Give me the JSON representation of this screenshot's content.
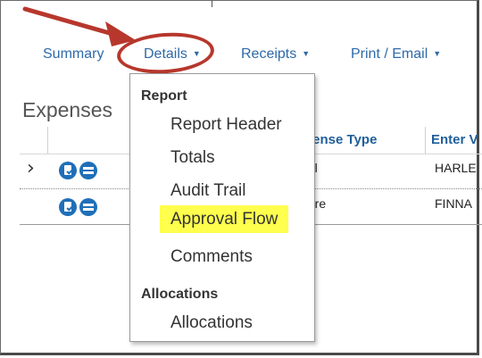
{
  "nav": {
    "tabs": [
      {
        "label": "Summary",
        "has_caret": false
      },
      {
        "label": "Details",
        "has_caret": true
      },
      {
        "label": "Receipts",
        "has_caret": true
      },
      {
        "label": "Print / Email",
        "has_caret": true
      }
    ],
    "caret_glyph": "▼"
  },
  "section": {
    "title": "Expenses"
  },
  "table": {
    "columns": [
      "Expense Type",
      "Enter V"
    ],
    "column_display": [
      "pense Type",
      "Enter V"
    ],
    "rows": [
      {
        "expense_type": "tel",
        "vendor": "HARLE"
      },
      {
        "expense_type": "fare",
        "vendor": "FINNA"
      }
    ],
    "expander_glyph": "›"
  },
  "dropdown": {
    "groups": [
      {
        "label": "Report",
        "items": [
          "Report Header",
          "Totals",
          "Audit Trail",
          "Approval Flow",
          "Comments"
        ]
      },
      {
        "label": "Allocations",
        "items": [
          "Allocations"
        ]
      }
    ],
    "highlighted_item": "Approval Flow"
  },
  "colors": {
    "link": "#2e6aa8",
    "annotation": "#b7372c",
    "highlight": "#ffff4d",
    "icon": "#1f6fb8"
  },
  "icons": [
    "document-approve-icon",
    "list-icon",
    "chevron-right-icon",
    "arrow-annotation-icon"
  ]
}
